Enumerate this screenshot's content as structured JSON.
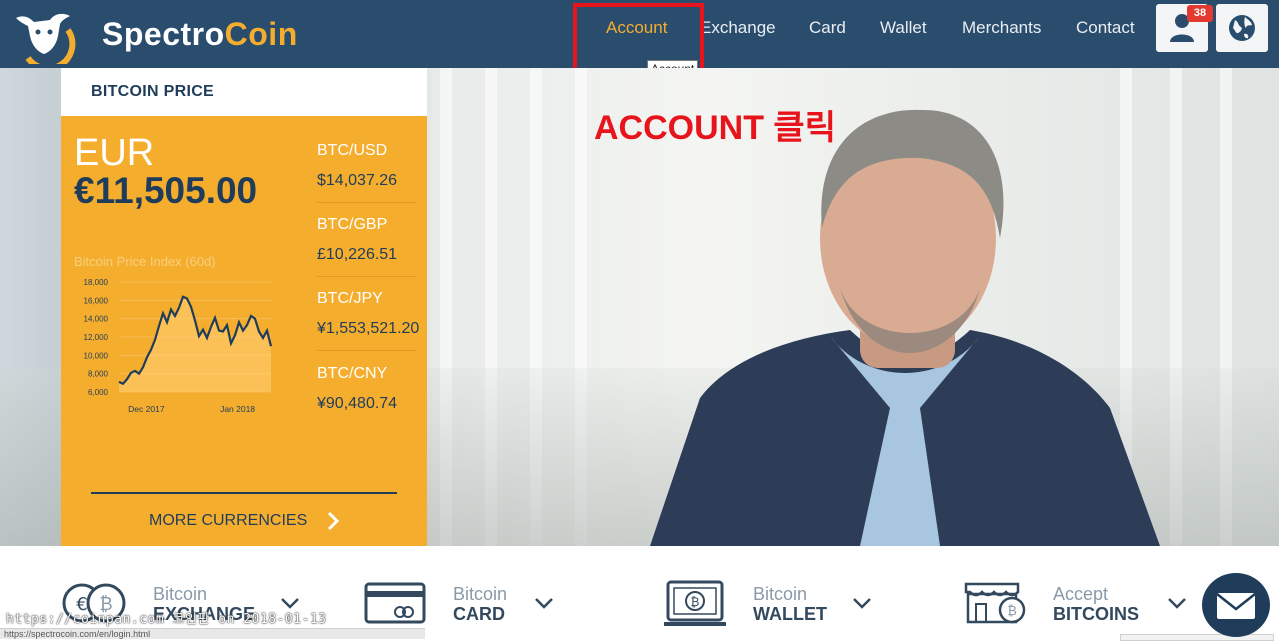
{
  "header": {
    "brand_prefix": "Spectro",
    "brand_suffix": "Coin",
    "nav": [
      {
        "label": "Account",
        "active": true
      },
      {
        "label": "Exchange"
      },
      {
        "label": "Card"
      },
      {
        "label": "Wallet"
      },
      {
        "label": "Merchants"
      },
      {
        "label": "Contact"
      }
    ],
    "tooltip": "Account",
    "notification_count": "38",
    "user_icon": "user-icon",
    "language_icon": "globe-icon"
  },
  "annotation": {
    "text": "ACCOUNT 클릭",
    "color": "#e8141b"
  },
  "price_panel": {
    "heading": "BITCOIN PRICE",
    "currency": "EUR",
    "price": "€11,505.00",
    "chart_title": "Bitcoin Price Index (60d)",
    "rates": [
      {
        "pair": "BTC/USD",
        "value": "$14,037.26"
      },
      {
        "pair": "BTC/GBP",
        "value": "£10,226.51"
      },
      {
        "pair": "BTC/JPY",
        "value": "¥1,553,521.20"
      },
      {
        "pair": "BTC/CNY",
        "value": "¥90,480.74"
      }
    ],
    "more_label": "MORE CURRENCIES",
    "accent": "#f5ad2e"
  },
  "chart_data": {
    "type": "area",
    "title": "Bitcoin Price Index (60d)",
    "y_ticks": [
      "18,000",
      "16,000",
      "14,000",
      "12,000",
      "10,000",
      "8,000",
      "6,000"
    ],
    "x_ticks": [
      "Dec 2017",
      "Jan 2018"
    ],
    "ylim": [
      6000,
      18000
    ],
    "values": [
      7100,
      6900,
      7400,
      8100,
      8300,
      8000,
      8700,
      9800,
      10600,
      11700,
      13200,
      14600,
      13600,
      15000,
      14300,
      15200,
      16400,
      16200,
      15300,
      13800,
      12100,
      12800,
      11900,
      13100,
      14100,
      12700,
      12600,
      13300,
      11300,
      12200,
      13600,
      12700,
      13300,
      14300,
      14000,
      12600,
      11900,
      12700,
      11000
    ]
  },
  "features": [
    {
      "line1": "Bitcoin",
      "line2": "EXCHANGE",
      "icon": "coins-icon"
    },
    {
      "line1": "Bitcoin",
      "line2": "CARD",
      "icon": "card-icon"
    },
    {
      "line1": "Bitcoin",
      "line2": "WALLET",
      "icon": "wallet-icon"
    },
    {
      "line1": "Accept",
      "line2": "BITCOINS",
      "icon": "shop-icon"
    }
  ],
  "watermark": "https://coinpan.com 코인판 on 2018-01-13",
  "status_url": "https://spectrocoin.com/en/login.html",
  "chat_icon": "mail-icon"
}
